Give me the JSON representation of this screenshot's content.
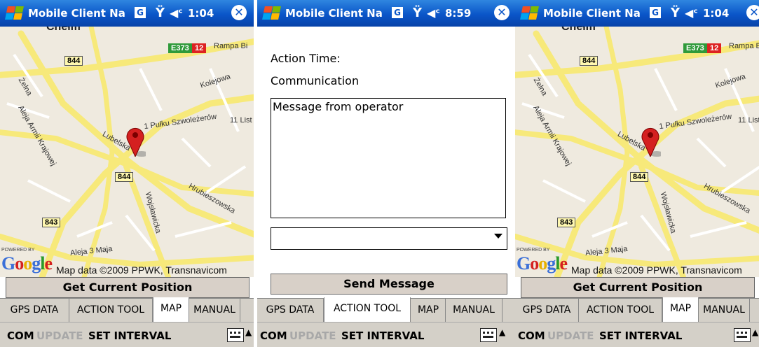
{
  "title_bar": {
    "app_title": "Mobile Client Na",
    "network_badge": "G",
    "signal_icon": "signal-icon",
    "speaker_icon": "speaker-icon",
    "close_icon": "close-icon"
  },
  "screens": [
    {
      "clock": "1:04",
      "button": "Get Current Position",
      "active_tab": "MAP"
    },
    {
      "clock": "8:59",
      "button": "Send Message",
      "active_tab": "ACTION TOOL"
    },
    {
      "clock": "1:04",
      "button": "Get Current Position",
      "active_tab": "MAP"
    }
  ],
  "map": {
    "city_label": "Chełm",
    "e_route": "E373",
    "red_badge": "12",
    "street_rampa": "Rampa Bi",
    "street_kolejowa": "Kolejowa",
    "street_zelna": "Żelna",
    "road_844": "844",
    "road_843": "843",
    "street_pulku": "1 Pułku Szwoleżerów",
    "street_11listo": "11 List",
    "street_armii": "Aleja Armii Krajowej",
    "street_lubelska": "Lubelska",
    "street_hrubieszowska": "Hrubieszowska",
    "street_wojslawicka": "Wojsławicka",
    "street_3maja": "Aleja 3 Maja",
    "powered_by": "POWERED BY",
    "google": "Google",
    "map_data": "Map data ©2009 PPWK, Transnavicom"
  },
  "form": {
    "action_time_label": "Action Time:",
    "communication_label": "Communication",
    "message_value": "Message from operator",
    "combo_value": ""
  },
  "tabs": [
    "GPS DATA",
    "ACTION TOOL",
    "MAP",
    "MANUAL"
  ],
  "menu": {
    "com": "COM",
    "update": "UPDATE",
    "set_interval": "SET INTERVAL",
    "keyboard_icon": "keyboard-icon",
    "caret": "▲"
  },
  "colors": {
    "titlebar": "#0a55c8",
    "road_yellow": "#f7e97a",
    "map_bg": "#efeadf",
    "pin_red": "#d42020",
    "tab_bg": "#d4d0c8"
  }
}
